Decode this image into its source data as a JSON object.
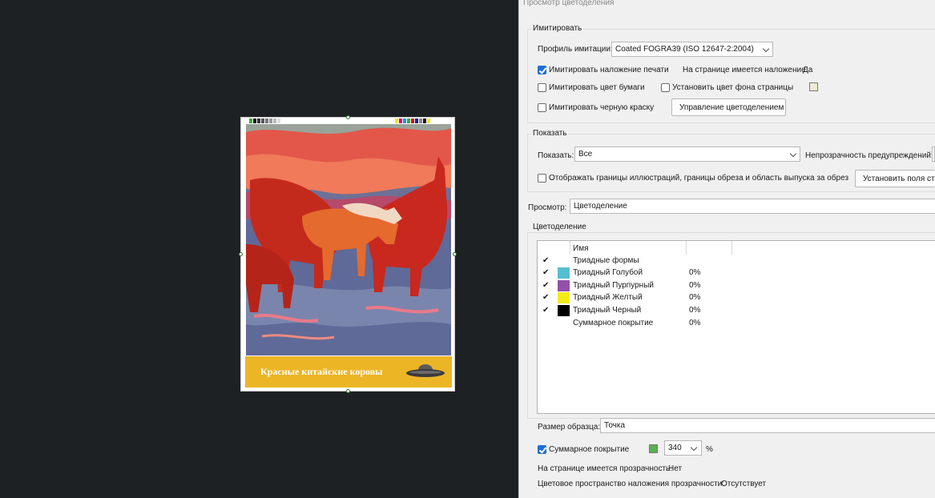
{
  "artwork": {
    "title": "Красные китайские коровы",
    "colorbar_left": [
      "#3aaa35",
      "#111111",
      "#333333",
      "#555555",
      "#777777",
      "#999999",
      "#bbbbbb",
      "#dddddd",
      "#ffffff"
    ],
    "colorbar_right": [
      "#f6e600",
      "#e4007c",
      "#00a0e9",
      "#3aaa35",
      "#e60012",
      "#1d2088",
      "#888888",
      "#111111",
      "#f6e600"
    ]
  },
  "panel": {
    "window_title": "Просмотр цветоделения",
    "simulate": {
      "group_title": "Имитировать",
      "profile_label": "Профиль имитации:",
      "profile_value": "Coated FOGRA39 (ISO 12647-2:2004)",
      "overprint_label": "Имитировать наложение печати",
      "overprint_checked": true,
      "page_has_overprint_label": "На странице имеется наложение:",
      "page_has_overprint_value": "Да",
      "paper_color_label": "Имитировать цвет бумаги",
      "paper_color_checked": false,
      "page_bg_label": "Установить цвет фона страницы",
      "page_bg_checked": false,
      "black_ink_label": "Имитировать черную краску",
      "black_ink_checked": false,
      "color_mgmt_button": "Управление цветоделением"
    },
    "show": {
      "group_title": "Показать",
      "show_label": "Показать:",
      "show_value": "Все",
      "warning_opacity_label": "Непрозрачность предупреждений:",
      "display_boxes_label": "Отображать границы иллюстраций, границы обреза и область выпуска за обрез",
      "display_boxes_checked": false,
      "set_fields_button": "Установить поля стр"
    },
    "preview": {
      "label": "Просмотр:",
      "value": "Цветоделение"
    },
    "separations": {
      "group_title": "Цветоделение",
      "column_name": "Имя",
      "rows": [
        {
          "checked": true,
          "color": "",
          "name": "Триадные формы",
          "value": ""
        },
        {
          "checked": true,
          "color": "#55bfd0",
          "name": "Триадный Голубой",
          "value": "0%"
        },
        {
          "checked": true,
          "color": "#9350a8",
          "name": "Триадный Пурпурный",
          "value": "0%"
        },
        {
          "checked": true,
          "color": "#f2ec18",
          "name": "Триадный Желтый",
          "value": "0%"
        },
        {
          "checked": true,
          "color": "#000000",
          "name": "Триадный Черный",
          "value": "0%"
        },
        {
          "checked": false,
          "color": "",
          "name": "Суммарное покрытие",
          "value": "0%"
        }
      ]
    },
    "sample": {
      "label": "Размер образца:",
      "value": "Точка"
    },
    "coverage": {
      "label": "Суммарное покрытие",
      "checked": true,
      "swatch_color": "#58b052",
      "value": "340",
      "unit": "%"
    },
    "transparency": {
      "label": "На странице имеется прозрачность:",
      "value": "Нет",
      "space_label": "Цветовое пространство наложения прозрачности:",
      "space_value": "Отсутствует"
    }
  }
}
